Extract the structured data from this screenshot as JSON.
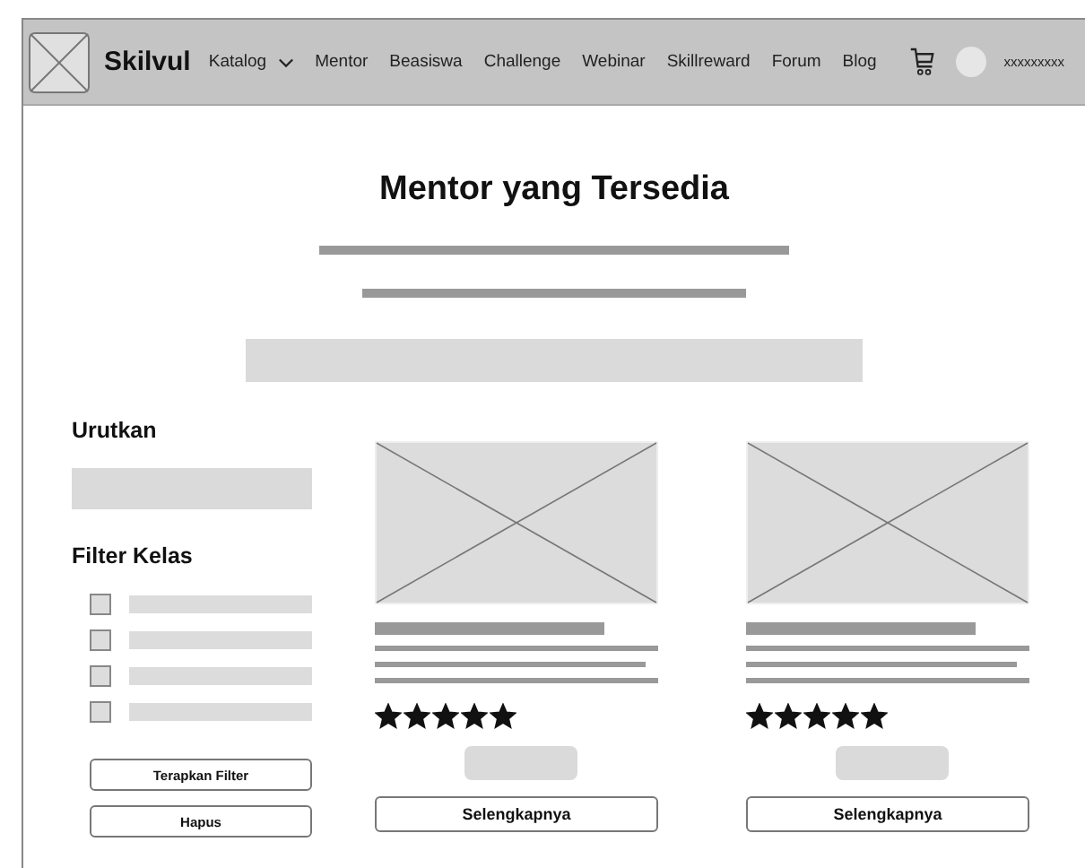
{
  "navbar": {
    "brand": "Skilvul",
    "menu": [
      {
        "label": "Katalog",
        "kind": "dropdown"
      },
      {
        "label": "Mentor",
        "kind": "link"
      },
      {
        "label": "Beasiswa",
        "kind": "link"
      },
      {
        "label": "Challenge",
        "kind": "link"
      },
      {
        "label": "Webinar",
        "kind": "link"
      },
      {
        "label": "Skillreward",
        "kind": "link"
      },
      {
        "label": "Forum",
        "kind": "link"
      },
      {
        "label": "Blog",
        "kind": "link"
      }
    ],
    "username": "xxxxxxxxx"
  },
  "heading": "Mentor yang Tersedia",
  "sidebar": {
    "sort_label": "Urutkan",
    "filter_label": "Filter Kelas",
    "filters": [
      {
        "checked": false
      },
      {
        "checked": false
      },
      {
        "checked": false
      },
      {
        "checked": false
      }
    ],
    "buttons": [
      "Terapkan Filter",
      "Hapus"
    ]
  },
  "mentors": [
    {
      "stars": 5,
      "button": "Selengkapnya"
    },
    {
      "stars": 5,
      "button": "Selengkapnya"
    }
  ]
}
